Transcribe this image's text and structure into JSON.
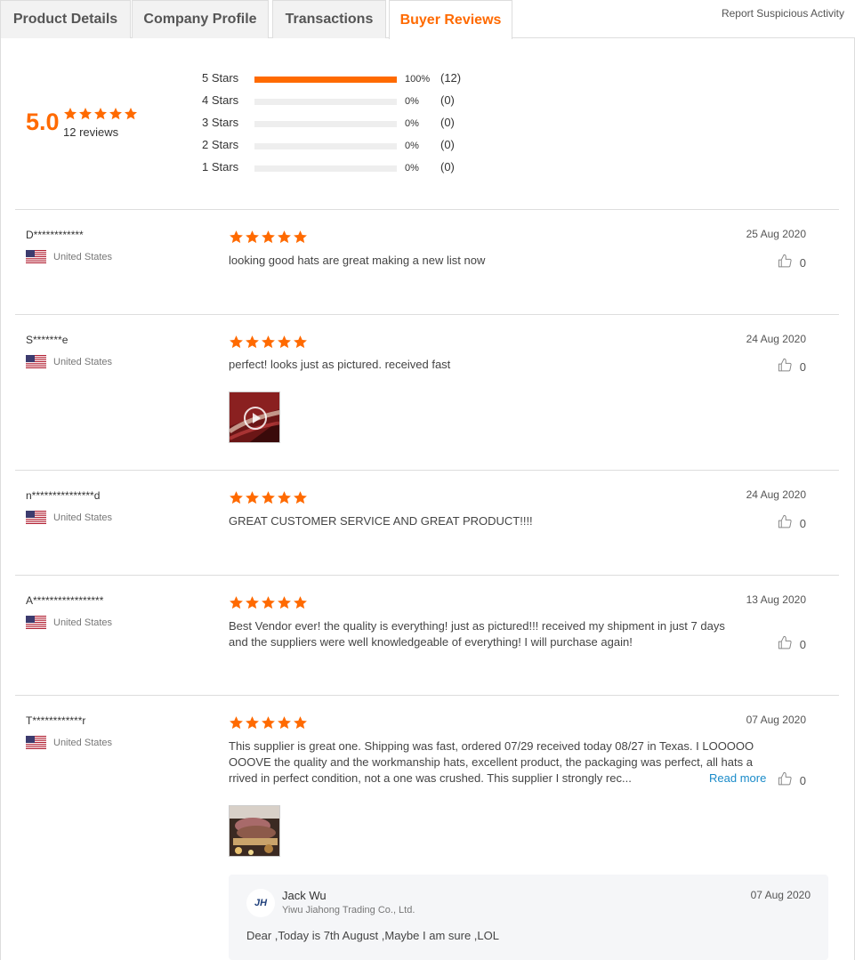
{
  "colors": {
    "accent": "#ff6a00",
    "link": "#1a8bc9"
  },
  "tabs": [
    {
      "label": "Product Details",
      "active": false
    },
    {
      "label": "Company Profile",
      "active": false
    },
    {
      "label": "Transactions",
      "active": false
    },
    {
      "label": "Buyer Reviews",
      "active": true
    }
  ],
  "report_link": "Report Suspicious Activity",
  "summary": {
    "score": "5.0",
    "stars": 5,
    "review_count": "12 reviews",
    "breakdown": [
      {
        "label": "5  Stars",
        "percent_text": "100%",
        "count": "(12)",
        "fraction": 1.0
      },
      {
        "label": "4  Stars",
        "percent_text": "0%",
        "count": "(0)",
        "fraction": 0
      },
      {
        "label": "3  Stars",
        "percent_text": "0%",
        "count": "(0)",
        "fraction": 0
      },
      {
        "label": "2  Stars",
        "percent_text": "0%",
        "count": "(0)",
        "fraction": 0
      },
      {
        "label": "1  Stars",
        "percent_text": "0%",
        "count": "(0)",
        "fraction": 0
      }
    ]
  },
  "reviews": [
    {
      "name": "D************",
      "country": "United States",
      "flag_icon": "us-flag-icon",
      "rating": 5,
      "date": "25 Aug 2020",
      "text": "looking good hats are great making a new list  now",
      "likes": "0"
    },
    {
      "name": "S*******e",
      "country": "United States",
      "flag_icon": "us-flag-icon",
      "rating": 5,
      "date": "24 Aug 2020",
      "text": "perfect! looks just as pictured. received fast",
      "likes": "0",
      "media": "video-thumbnail"
    },
    {
      "name": "n***************d",
      "country": "United States",
      "flag_icon": "us-flag-icon",
      "rating": 5,
      "date": "24 Aug 2020",
      "text": "GREAT CUSTOMER SERVICE AND GREAT PRODUCT!!!!",
      "likes": "0"
    },
    {
      "name": "A*****************",
      "country": "United States",
      "flag_icon": "us-flag-icon",
      "rating": 5,
      "date": "13 Aug 2020",
      "text": "Best Vendor ever! the quality is everything! just as pictured!!! received my shipment in just 7 days and the suppliers were well knowledgeable of everything! I will purchase again!",
      "likes": "0"
    },
    {
      "name": "T************r",
      "country": "United States",
      "flag_icon": "us-flag-icon",
      "rating": 5,
      "date": "07 Aug 2020",
      "text_lines": [
        "This supplier is great one. Shipping was fast, ordered 07/29 received today 08/27 in Texas. I LOOOOO",
        "OOOVE the quality and the workmanship hats, excellent product, the packaging was perfect, all hats a",
        "rrived in perfect condition, not a one was crushed. This supplier I strongly rec..."
      ],
      "read_more": "Read more",
      "likes": "0",
      "media": "photo-thumbnail",
      "reply": {
        "avatar_text": "JH",
        "name": "Jack Wu",
        "company": "Yiwu Jiahong Trading Co., Ltd.",
        "date": "07 Aug 2020",
        "text": "Dear ,Today is 7th August ,Maybe I am sure ,LOL"
      }
    }
  ]
}
